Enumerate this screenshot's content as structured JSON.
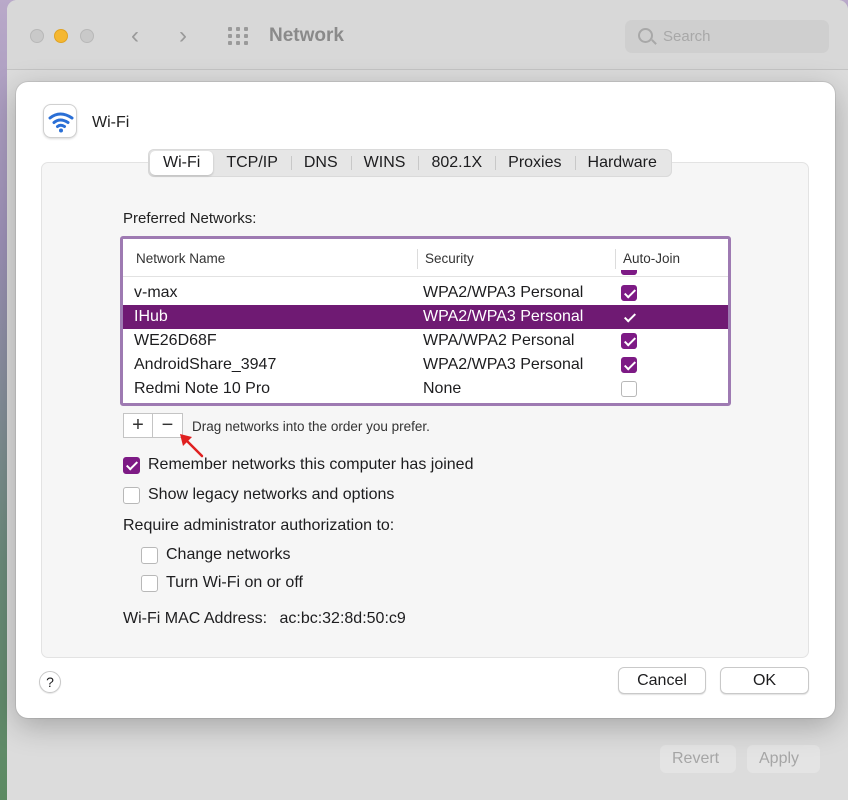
{
  "window": {
    "title": "Network",
    "search_placeholder": "Search",
    "revert_label": "Revert",
    "apply_label": "Apply"
  },
  "dialog": {
    "title": "Wi-Fi",
    "icon": "wifi-icon",
    "tabs": [
      {
        "label": "Wi-Fi",
        "active": true
      },
      {
        "label": "TCP/IP",
        "active": false
      },
      {
        "label": "DNS",
        "active": false
      },
      {
        "label": "WINS",
        "active": false
      },
      {
        "label": "802.1X",
        "active": false
      },
      {
        "label": "Proxies",
        "active": false
      },
      {
        "label": "Hardware",
        "active": false
      }
    ],
    "preferred_label": "Preferred Networks:",
    "table": {
      "columns": [
        "Network Name",
        "Security",
        "Auto-Join"
      ],
      "rows": [
        {
          "name": "v-max",
          "security": "WPA2/WPA3 Personal",
          "auto_join": true,
          "selected": false
        },
        {
          "name": "IHub",
          "security": "WPA2/WPA3 Personal",
          "auto_join": true,
          "selected": true
        },
        {
          "name": "WE26D68F",
          "security": "WPA/WPA2 Personal",
          "auto_join": true,
          "selected": false
        },
        {
          "name": "AndroidShare_3947",
          "security": "WPA2/WPA3 Personal",
          "auto_join": true,
          "selected": false
        },
        {
          "name": "Redmi Note 10 Pro",
          "security": "None",
          "auto_join": false,
          "selected": false
        }
      ]
    },
    "add_label": "+",
    "remove_label": "−",
    "drag_hint": "Drag networks into the order you prefer.",
    "options": [
      {
        "label": "Remember networks this computer has joined",
        "checked": true
      },
      {
        "label": "Show legacy networks and options",
        "checked": false
      }
    ],
    "require_label": "Require administrator authorization to:",
    "admin_options": [
      {
        "label": "Change networks",
        "checked": false
      },
      {
        "label": "Turn Wi-Fi on or off",
        "checked": false
      }
    ],
    "mac_label": "Wi-Fi MAC Address:",
    "mac_value": "ac:bc:32:8d:50:c9",
    "help_label": "?",
    "cancel_label": "Cancel",
    "ok_label": "OK"
  },
  "colors": {
    "accent": "#7d1a85",
    "selection": "#6f1a73",
    "table_focus_border": "#9e7ab2",
    "annotation_arrow": "#e02020"
  }
}
